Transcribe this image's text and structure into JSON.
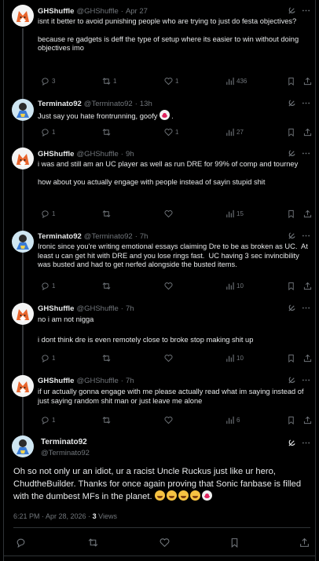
{
  "thread": [
    {
      "name": "GHShuffle",
      "handle": "@GHShuffle",
      "time": "Apr 27",
      "avatar": "fox-avatar",
      "body": [
        "isnt it better to avoid punishing people who are trying to just do festa objectives?",
        "because re gadgets is deff the type of setup where its easier to win without doing objectives imo"
      ],
      "replies": "3",
      "reposts": "1",
      "likes": "1",
      "views": "436"
    },
    {
      "name": "Terminato92",
      "handle": "@Terminato92",
      "time": "13h",
      "avatar": "character-avatar",
      "body": [
        "Just say you hate frontrunning, goofy"
      ],
      "body_emoji": "clown-emoji",
      "body_suffix": ".",
      "replies": "1",
      "reposts": "",
      "likes": "1",
      "views": "27"
    },
    {
      "name": "GHShuffle",
      "handle": "@GHShuffle",
      "time": "9h",
      "avatar": "fox-avatar",
      "body": [
        "i was and still am an UC player as well as run DRE for 99% of comp and tourney",
        "how about you actually engage with people instead of sayin stupid shit"
      ],
      "replies": "1",
      "reposts": "",
      "likes": "",
      "views": "15"
    },
    {
      "name": "Terminato92",
      "handle": "@Terminato92",
      "time": "7h",
      "avatar": "character-avatar",
      "body": [
        "Ironic since you're writing emotional essays claiming Dre to be as broken as UC.  At least u can get hit with DRE and you lose rings fast.  UC having 3 sec invincibility was busted and had to get nerfed alongside the busted items."
      ],
      "replies": "1",
      "reposts": "",
      "likes": "",
      "views": "10"
    },
    {
      "name": "GHShuffle",
      "handle": "@GHShuffle",
      "time": "7h",
      "avatar": "fox-avatar",
      "body": [
        "no i am not nigga",
        "i dont think dre is even remotely close to broke stop making shit up"
      ],
      "replies": "1",
      "reposts": "",
      "likes": "",
      "views": "10"
    },
    {
      "name": "GHShuffle",
      "handle": "@GHShuffle",
      "time": "7h",
      "avatar": "fox-avatar",
      "body": [
        "if ur actually gonna engage with me please actually read what im saying instead of just saying random shit man or just leave me alone"
      ],
      "replies": "1",
      "reposts": "",
      "likes": "",
      "views": "6"
    }
  ],
  "main": {
    "name": "Terminato92",
    "handle": "@Terminato92",
    "body": "Oh so not only ur an idiot, ur a racist Uncle Ruckus just like ur hero, ChudtheBuilder.  Thanks for once again proving that Sonic fanbase is filled with the dumbest MFs in the planet.",
    "body_emojis": [
      "laughing-crying-emoji",
      "grinning-sweat-emoji",
      "rofl-emoji",
      "rofl-emoji",
      "clown-emoji"
    ],
    "timestamp": "6:21 PM · Apr 28, 2026",
    "views_count": "3",
    "views_label": "Views"
  },
  "icons": {
    "reply": "reply-icon",
    "repost": "repost-icon",
    "like": "heart-icon",
    "views": "views-icon",
    "bookmark": "bookmark-icon",
    "share": "share-icon",
    "grok": "grok-icon",
    "more": "more-icon"
  },
  "colors": {
    "background": "#000000",
    "text": "#e7e9ea",
    "muted": "#71767b",
    "border": "#2f3336"
  }
}
